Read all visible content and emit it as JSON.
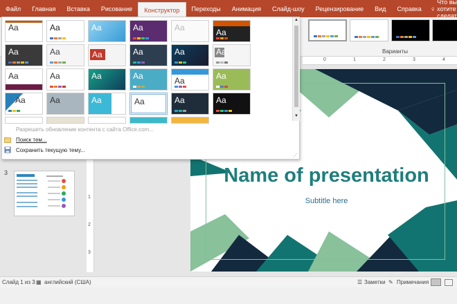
{
  "ribbon_tabs": [
    "Файл",
    "Главная",
    "Вставка",
    "Рисование",
    "Конструктор",
    "Переходы",
    "Анимация",
    "Слайд-шоу",
    "Рецензирование",
    "Вид",
    "Справка"
  ],
  "tell_me": "Что вы хотите сделать?",
  "variants_label": "Варианты",
  "themes_menu": {
    "enable_updates": "Разрешить обновление контента с сайта Office.com...",
    "browse": "Поиск тем...",
    "save": "Сохранить текущую тему..."
  },
  "theme_label": "Aa",
  "ruler_h": [
    "0",
    "1",
    "2",
    "3",
    "4"
  ],
  "ruler_v": [
    "1",
    "2",
    "3"
  ],
  "slide_number": "3",
  "slide": {
    "title": "Name of presentation",
    "subtitle": "Subtitle here"
  },
  "status": {
    "slide_info": "Слайд 1 из 3",
    "language": "английский (США)",
    "notes": "Заметки",
    "comments": "Примечания"
  },
  "colors": {
    "ribbon_accent": "#b7472a",
    "slide_title": "#1f7e7d",
    "slide_dark": "#13293d",
    "slide_teal": "#127470",
    "slide_green": "#88c19a"
  }
}
